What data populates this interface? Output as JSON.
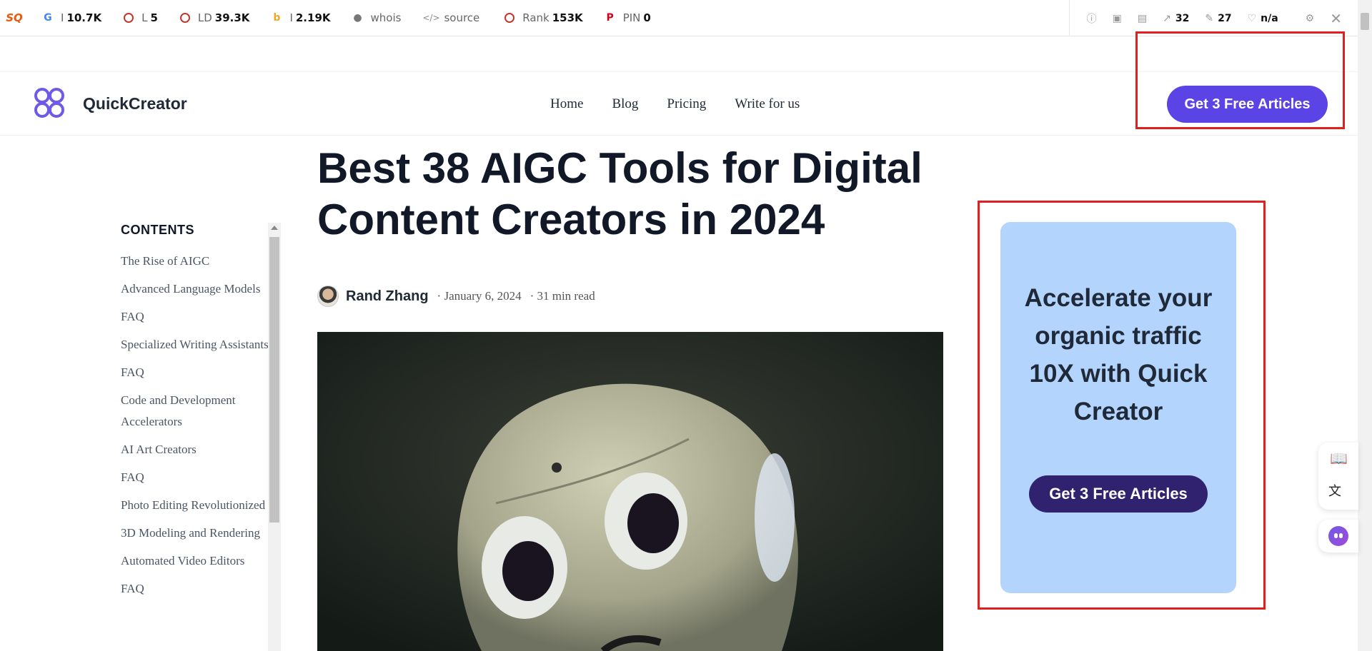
{
  "seo_toolbar": {
    "metrics": [
      {
        "icon": "google-icon",
        "label": "I",
        "value": "10.7K"
      },
      {
        "icon": "circle-icon",
        "label": "L",
        "value": "5"
      },
      {
        "icon": "circle-icon",
        "label": "LD",
        "value": "39.3K"
      },
      {
        "icon": "bing-icon",
        "label": "I",
        "value": "2.19K"
      },
      {
        "icon": "person-icon",
        "label": "whois",
        "value": ""
      },
      {
        "icon": "code-icon",
        "label": "source",
        "value": ""
      },
      {
        "icon": "circle-icon",
        "label": "Rank",
        "value": "153K"
      },
      {
        "icon": "pinterest-icon",
        "label": "PIN",
        "value": "0"
      }
    ],
    "right_metrics": {
      "external_links": "32",
      "internal_links": "27",
      "health": "n/a"
    }
  },
  "header": {
    "brand": "QuickCreator",
    "nav": [
      "Home",
      "Blog",
      "Pricing",
      "Write for us"
    ],
    "cta": "Get 3 Free Articles"
  },
  "article": {
    "title": "Best 38 AIGC Tools for Digital Content Creators in 2024",
    "author": "Rand Zhang",
    "date": "· January 6, 2024",
    "read_time": "· 31 min read"
  },
  "toc": {
    "title": "CONTENTS",
    "items": [
      "The Rise of AIGC",
      "Advanced Language Models",
      "FAQ",
      "Specialized Writing Assistants",
      "FAQ",
      "Code and Development Accelerators",
      "AI Art Creators",
      "FAQ",
      "Photo Editing Revolutionized",
      "3D Modeling and Rendering",
      "Automated Video Editors",
      "FAQ"
    ]
  },
  "ad": {
    "headline": "Accelerate your organic traffic 10X with Quick Creator",
    "cta": "Get 3 Free Articles",
    "background": "#b3d4fc"
  },
  "colors": {
    "accent": "#5b44e5",
    "ad_button": "#30226e",
    "highlight_box": "#e02020"
  }
}
